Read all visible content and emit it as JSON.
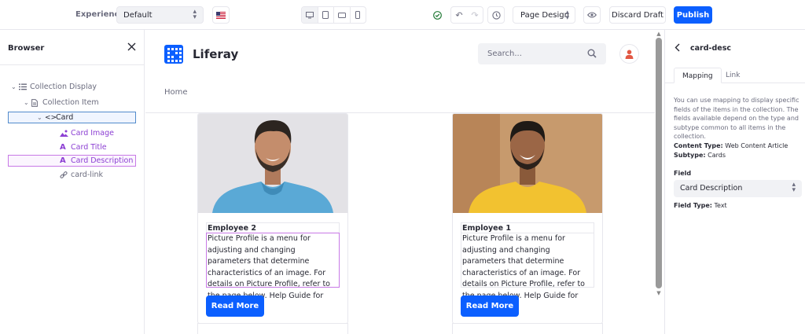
{
  "toolbar": {
    "experience_label": "Experience",
    "experience_value": "Default",
    "language": "en-US flag",
    "devices": [
      "desktop-icon",
      "tablet-icon",
      "landscape-phone-icon",
      "phone-icon"
    ],
    "mode_label": "Page Design",
    "discard_label": "Discard Draft",
    "publish_label": "Publish"
  },
  "browser": {
    "title": "Browser",
    "tree": [
      {
        "label": "Collection Display",
        "icon": "list-icon"
      },
      {
        "label": "Collection Item",
        "icon": "page-icon"
      },
      {
        "label": "Card",
        "icon": "code-icon"
      },
      {
        "label": "Card Image",
        "icon": "image-icon"
      },
      {
        "label": "Card Title",
        "icon": "text-icon"
      },
      {
        "label": "Card Description",
        "icon": "text-icon"
      },
      {
        "label": "card-link",
        "icon": "link-icon"
      }
    ]
  },
  "site": {
    "logo_text": "Liferay",
    "search_placeholder": "Search...",
    "nav_home": "Home"
  },
  "cards": [
    {
      "title": "Employee 2",
      "description": "Picture Profile is a menu for adjusting and changing parameters that determine characteristics of an image. For details on Picture Profile, refer to the page below. Help Guide for Creators",
      "button": "Read More"
    },
    {
      "title": "Employee 1",
      "description": "Picture Profile is a menu for adjusting and changing parameters that determine characteristics of an image. For details on Picture Profile, refer to the page below. Help Guide for Creators",
      "button": "Read More"
    }
  ],
  "config": {
    "title": "card-desc",
    "tabs": [
      "Mapping",
      "Link"
    ],
    "help_text": "You can use mapping to display specific fields of the items in the collection. The fields available depend on the type and subtype common to all items in the collection.",
    "content_type_label": "Content Type:",
    "content_type_value": "Web Content Article",
    "subtype_label": "Subtype:",
    "subtype_value": "Cards",
    "field_label": "Field",
    "field_value": "Card Description",
    "field_type_label": "Field Type:",
    "field_type_value": "Text"
  },
  "colors": {
    "primary": "#0b5fff",
    "mapped_highlight": "#c879e6",
    "selected_highlight": "#528bcc"
  }
}
